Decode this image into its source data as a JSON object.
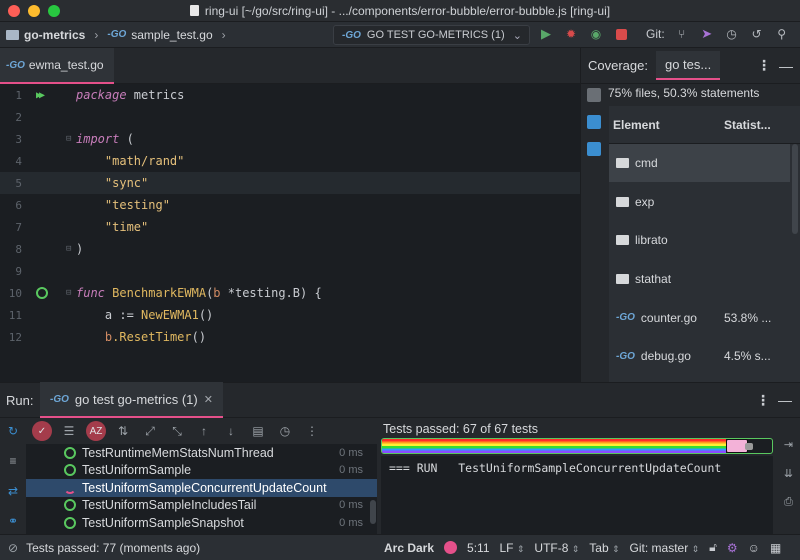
{
  "window": {
    "title": "ring-ui [~/go/src/ring-ui] - .../components/error-bubble/error-bubble.js [ring-ui]"
  },
  "navbar": {
    "project": "go-metrics",
    "file": "sample_test.go",
    "run_config": "GO TEST GO-METRICS (1)",
    "git_label": "Git:"
  },
  "editor": {
    "tab_label": "ewma_test.go",
    "lines": [
      {
        "n": "1"
      },
      {
        "n": "2"
      },
      {
        "n": "3"
      },
      {
        "n": "4"
      },
      {
        "n": "5"
      },
      {
        "n": "6"
      },
      {
        "n": "7"
      },
      {
        "n": "8"
      },
      {
        "n": "9"
      },
      {
        "n": "10"
      },
      {
        "n": "11"
      },
      {
        "n": "12"
      }
    ],
    "code": {
      "l1_kw": "package",
      "l1_rest": " metrics",
      "l3_kw": "import",
      "l3_rest": " (",
      "l4": "\"math/rand\"",
      "l5": "\"sync\"",
      "l6": "\"testing\"",
      "l7": "\"time\"",
      "l8": ")",
      "l10_kw": "func",
      "l10_name": " BenchmarkEWMA",
      "l10_open": "(",
      "l10_param": "b",
      "l10_rest": " *testing.B) {",
      "l11_var": "a := ",
      "l11_call": "NewEWMA1",
      "l11_rest": "()",
      "l12_obj": "b",
      "l12_call": ".ResetTimer",
      "l12_rest": "()"
    }
  },
  "coverage": {
    "label": "Coverage:",
    "tab": "go tes...",
    "summary": "75% files, 50.3% statements",
    "col_element": "Element",
    "col_stat": "Statist...",
    "rows": [
      {
        "name": "cmd",
        "stat": ""
      },
      {
        "name": "exp",
        "stat": ""
      },
      {
        "name": "librato",
        "stat": ""
      },
      {
        "name": "stathat",
        "stat": ""
      },
      {
        "name": "counter.go",
        "stat": "53.8% ..."
      },
      {
        "name": "debug.go",
        "stat": "4.5% s..."
      }
    ]
  },
  "run": {
    "label": "Run:",
    "tab": "go test go-metrics (1)",
    "tests": [
      {
        "name": "TestRuntimeMemStatsNumThread",
        "time": "0 ms"
      },
      {
        "name": "TestUniformSample",
        "time": "0 ms"
      },
      {
        "name": "TestUniformSampleConcurrentUpdateCount",
        "time": ""
      },
      {
        "name": "TestUniformSampleIncludesTail",
        "time": "0 ms"
      },
      {
        "name": "TestUniformSampleSnapshot",
        "time": "0 ms"
      }
    ],
    "tests_passed_label": "Tests passed:",
    "tests_passed_value": "67 of 67 tests",
    "progress": 1.0,
    "console_line": "=== RUN   TestUniformSampleConcurrentUpdateCount"
  },
  "status": {
    "message": "Tests passed: 77 (moments ago)",
    "theme": "Arc Dark",
    "position": "5:11",
    "line_sep": "LF",
    "encoding": "UTF-8",
    "indent": "Tab",
    "branch": "Git: master"
  },
  "colors": {
    "accent": "#e5508a",
    "pass_green": "#59c85f",
    "background": "#1e2227"
  }
}
